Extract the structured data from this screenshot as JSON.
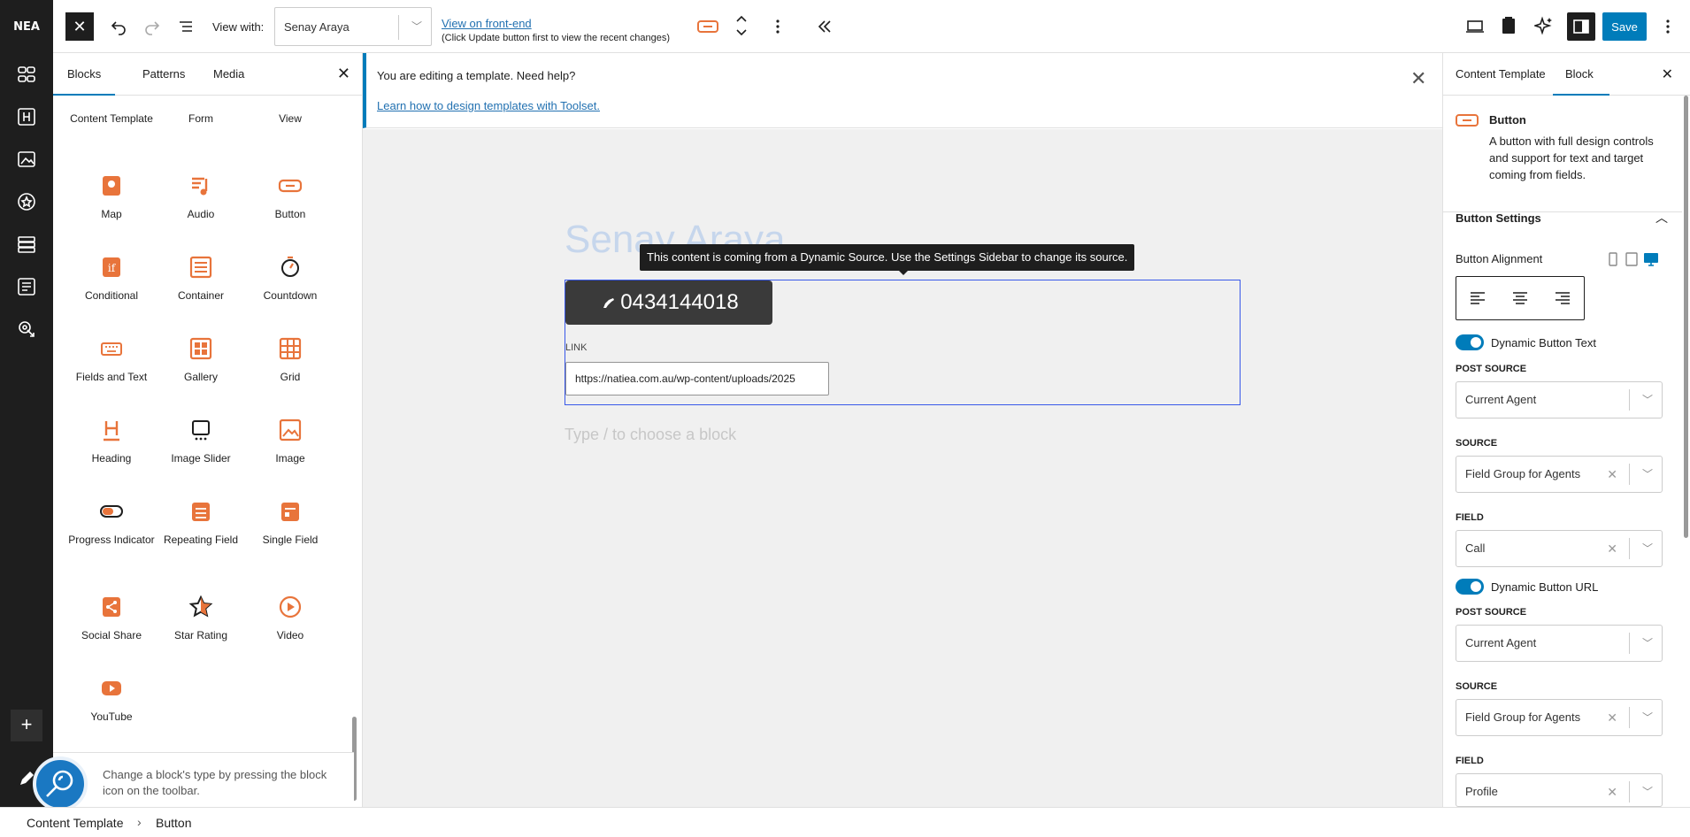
{
  "rail": {
    "logo_text": "NEA"
  },
  "toolbar": {
    "close_label": "✕",
    "view_with_label": "View with:",
    "view_with_value": "Senay Araya",
    "view_frontend_link": "View on front-end",
    "view_frontend_note": "(Click Update button first to view the recent changes)",
    "save_label": "Save"
  },
  "inserter": {
    "tabs": [
      "Blocks",
      "Patterns",
      "Media"
    ],
    "close_label": "✕",
    "blocks_top_row": [
      "Content Template",
      "Form",
      "View"
    ],
    "blocks": [
      {
        "label": "Map",
        "icon": "map-pin-icon"
      },
      {
        "label": "Audio",
        "icon": "music-note-icon"
      },
      {
        "label": "Button",
        "icon": "button-icon"
      },
      {
        "label": "Conditional",
        "icon": "conditional-icon"
      },
      {
        "label": "Container",
        "icon": "container-icon"
      },
      {
        "label": "Countdown",
        "icon": "stopwatch-icon"
      },
      {
        "label": "Fields and Text",
        "icon": "keyboard-icon"
      },
      {
        "label": "Gallery",
        "icon": "gallery-icon"
      },
      {
        "label": "Grid",
        "icon": "grid-icon"
      },
      {
        "label": "Heading",
        "icon": "heading-icon"
      },
      {
        "label": "Image Slider",
        "icon": "image-slider-icon"
      },
      {
        "label": "Image",
        "icon": "image-icon"
      },
      {
        "label": "Progress Indicator",
        "icon": "progress-toggle-icon"
      },
      {
        "label": "Repeating Field",
        "icon": "repeating-field-icon"
      },
      {
        "label": "Single Field",
        "icon": "single-field-icon"
      },
      {
        "label": "Social Share",
        "icon": "share-icon"
      },
      {
        "label": "Star Rating",
        "icon": "star-icon"
      },
      {
        "label": "Video",
        "icon": "play-icon"
      },
      {
        "label": "YouTube",
        "icon": "youtube-icon"
      }
    ],
    "tip": "Change a block's type by pressing the block icon on the toolbar."
  },
  "notice": {
    "text": "You are editing a template. Need help?",
    "link": "Learn how to design templates with Toolset."
  },
  "canvas": {
    "post_title": "Senay Araya",
    "tooltip": "This content is coming from a Dynamic Source. Use the Settings Sidebar to change its source.",
    "phone_text": "0434144018",
    "link_label": "LINK",
    "link_value": "https://natiea.com.au/wp-content/uploads/2025",
    "type_hint": "Type / to choose a block"
  },
  "sidebar": {
    "tabs": [
      "Content Template",
      "Block"
    ],
    "close_label": "✕",
    "block_title": "Button",
    "block_desc": "A button with full design controls and support for text and target coming from fields.",
    "panel_title": "Button Settings",
    "alignment_label": "Button Alignment",
    "toggle1": "Dynamic Button Text",
    "post_source_label": "POST SOURCE",
    "post_source_value": "Current Agent",
    "source_label": "SOURCE",
    "source_value": "Field Group for Agents",
    "field_label": "FIELD",
    "field1_value": "Call",
    "toggle2": "Dynamic Button URL",
    "post_source2_value": "Current Agent",
    "source2_value": "Field Group for Agents",
    "field2_value": "Profile"
  },
  "breadcrumb": {
    "items": [
      "Content Template",
      "Button"
    ]
  },
  "colors": {
    "accent": "#007cba",
    "block_icon": "#e8743b",
    "rail": "#1e1e1e"
  }
}
